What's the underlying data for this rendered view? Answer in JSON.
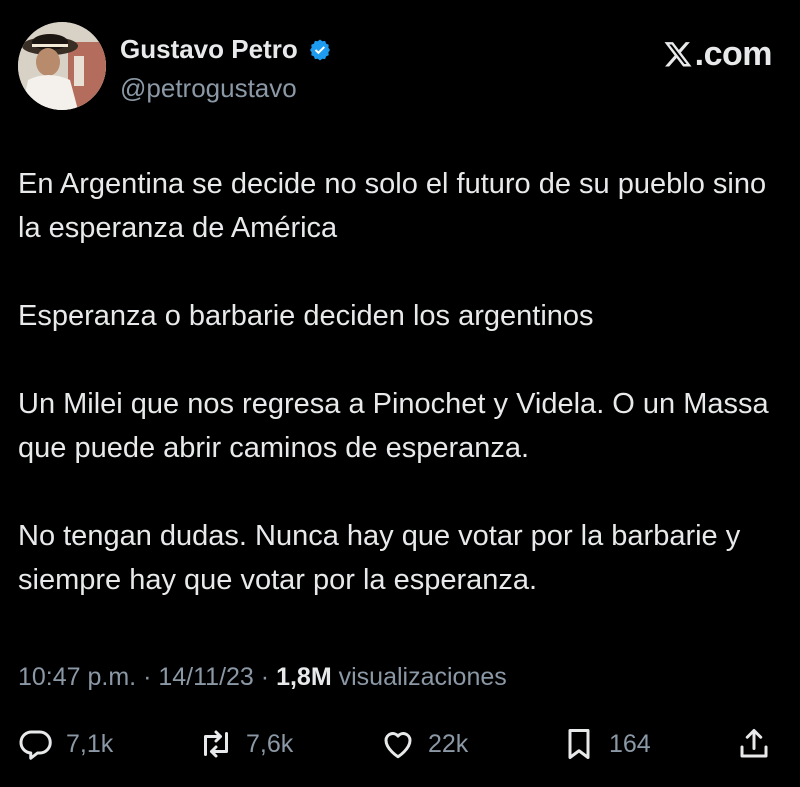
{
  "author": {
    "display_name": "Gustavo Petro",
    "handle": "@petrogustavo",
    "verified": true
  },
  "brand": {
    "site": ".com"
  },
  "tweet": {
    "paragraphs": [
      "En Argentina se decide no solo el futuro de su pueblo sino la esperanza de América",
      "Esperanza o barbarie deciden los argentinos",
      "Un Milei que nos regresa a Pinochet y Videla. O un Massa que puede abrir caminos de esperanza.",
      "No tengan dudas. Nunca hay que votar por la barbarie y siempre hay que votar por la esperanza."
    ]
  },
  "meta": {
    "time": "10:47 p.m.",
    "sep1": "·",
    "date": "14/11/23",
    "sep2": "·",
    "views_count": "1,8M",
    "views_label": "visualizaciones"
  },
  "actions": {
    "replies": "7,1k",
    "reposts": "7,6k",
    "likes": "22k",
    "bookmarks": "164"
  },
  "colors": {
    "background": "#000000",
    "text": "#e7e9ea",
    "muted": "#8b98a5",
    "verified": "#1d9bf0"
  }
}
